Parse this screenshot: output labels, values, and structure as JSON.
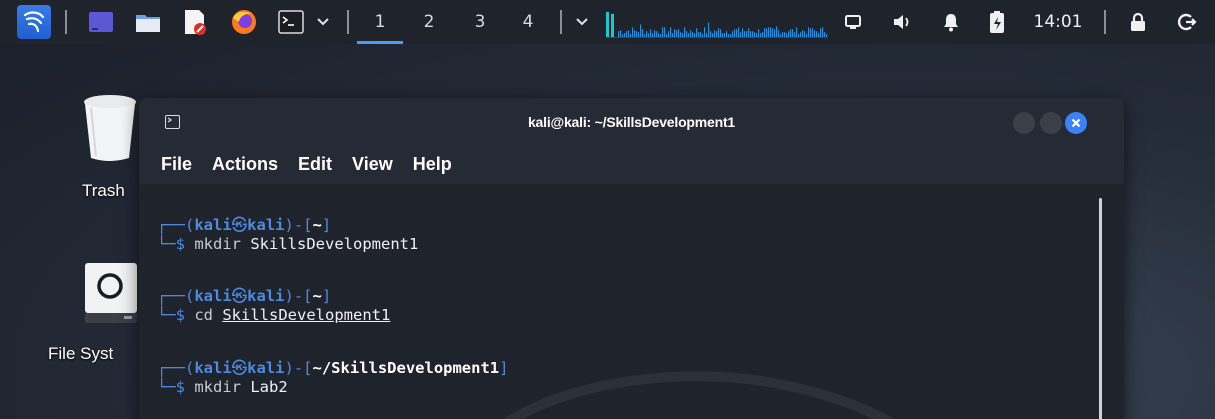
{
  "panel": {
    "workspaces": [
      {
        "label": "1",
        "active": true
      },
      {
        "label": "2",
        "active": false
      },
      {
        "label": "3",
        "active": false
      },
      {
        "label": "4",
        "active": false
      }
    ],
    "clock": "14:01",
    "icons": {
      "menu": "kali-dragon-icon",
      "show_desktop": "show-desktop-icon",
      "files": "file-manager-icon",
      "editor": "text-editor-icon",
      "browser": "firefox-icon",
      "terminal": "terminal-icon",
      "dropdown": "chevron-down-icon",
      "display": "display-icon",
      "volume": "volume-icon",
      "notifications": "bell-icon",
      "battery": "battery-charging-icon",
      "lock": "lock-icon",
      "logout": "logout-icon"
    },
    "accent_color": "#4a9ff5",
    "graph_color": "#1ec8c8"
  },
  "desktop": {
    "icons": [
      {
        "label": "Trash",
        "icon": "trash-icon"
      },
      {
        "label": "File Syst",
        "icon": "drive-icon"
      }
    ]
  },
  "terminal": {
    "title": "kali@kali: ~/SkillsDevelopment1",
    "menu": [
      "File",
      "Actions",
      "Edit",
      "View",
      "Help"
    ],
    "prompts": [
      {
        "user": "kali",
        "host": "kali",
        "path": "~",
        "command": "mkdir",
        "argument": "SkillsDevelopment1"
      },
      {
        "user": "kali",
        "host": "kali",
        "path": "~",
        "command": "cd",
        "argument": "SkillsDevelopment1"
      },
      {
        "user": "kali",
        "host": "kali",
        "path": "~/SkillsDevelopment1",
        "command": "mkdir",
        "argument": "Lab2"
      }
    ],
    "close_button_color": "#3b82f6"
  }
}
